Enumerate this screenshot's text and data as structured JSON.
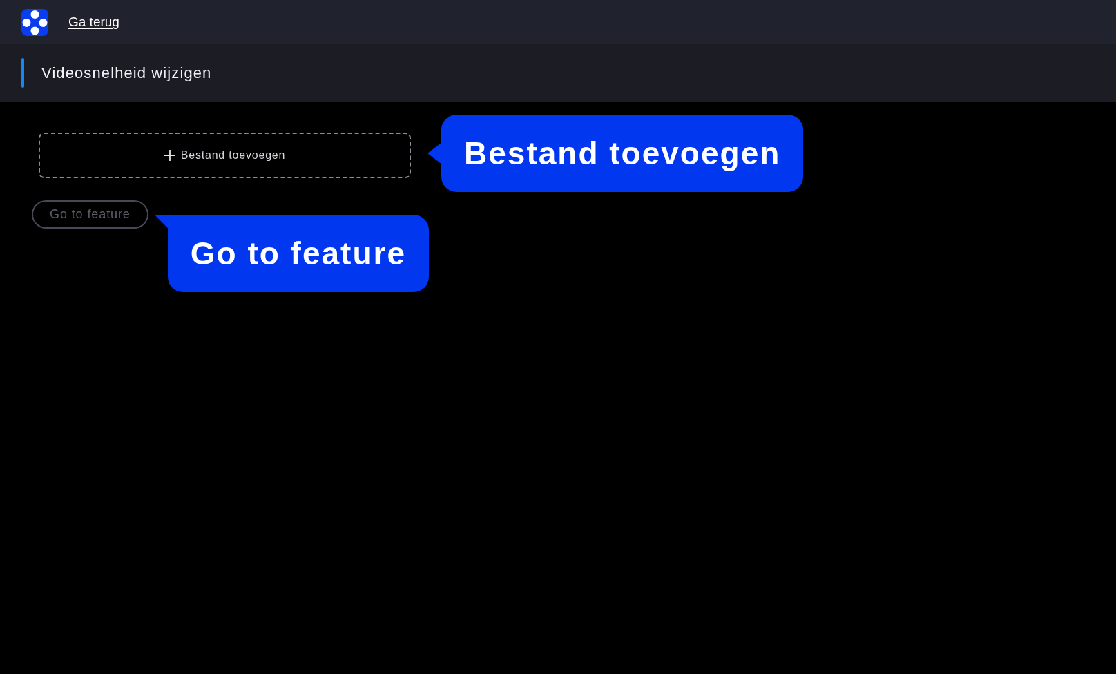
{
  "top_bar": {
    "back_link": "Ga terug"
  },
  "header": {
    "title": "Videosnelheid wijzigen"
  },
  "upload": {
    "label": "Bestand toevoegen",
    "tooltip": {
      "text": "Bestand toevoegen",
      "kind": "pointer-left"
    }
  },
  "feature_button": {
    "label": "Go to feature",
    "disabled": true,
    "tooltip": {
      "text": "Go to feature",
      "kind": "pointer-up-left"
    }
  }
}
